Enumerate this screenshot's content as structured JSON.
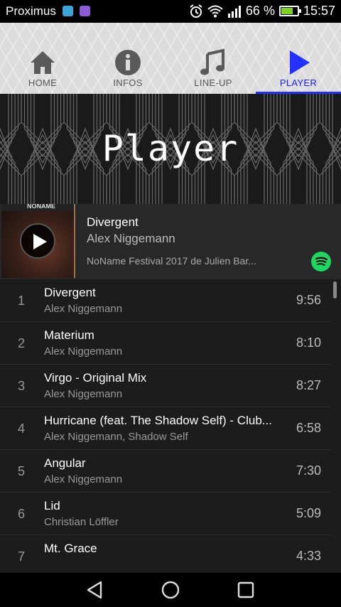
{
  "status_bar": {
    "carrier": "Proximus",
    "battery_percent": "66 %",
    "battery_level": 0.66,
    "time": "15:57",
    "icons": [
      "photo-app-icon",
      "app-icon",
      "alarm-icon",
      "wifi-icon",
      "signal-icon",
      "battery-icon"
    ]
  },
  "tabs": [
    {
      "label": "HOME",
      "icon": "home-icon"
    },
    {
      "label": "INFOS",
      "icon": "info-icon"
    },
    {
      "label": "LINE-UP",
      "icon": "music-note-icon"
    },
    {
      "label": "PLAYER",
      "icon": "play-icon",
      "active": true
    }
  ],
  "header": {
    "title": "Player"
  },
  "now_playing": {
    "track": "Divergent",
    "artist": "Alex Niggemann",
    "playlist": "NoName Festival 2017 de Julien Bar...",
    "album_text": "NONAME"
  },
  "tracks": [
    {
      "num": "1",
      "title": "Divergent",
      "artist": "Alex Niggemann",
      "duration": "9:56"
    },
    {
      "num": "2",
      "title": "Materium",
      "artist": "Alex Niggemann",
      "duration": "8:10"
    },
    {
      "num": "3",
      "title": "Virgo - Original Mix",
      "artist": "Alex Niggemann",
      "duration": "8:27"
    },
    {
      "num": "4",
      "title": "Hurricane (feat. The Shadow Self) - Club...",
      "artist": "Alex Niggemann, Shadow Self",
      "duration": "6:58"
    },
    {
      "num": "5",
      "title": "Angular",
      "artist": "Alex Niggemann",
      "duration": "7:30"
    },
    {
      "num": "6",
      "title": "Lid",
      "artist": "Christian Löffler",
      "duration": "5:09"
    },
    {
      "num": "7",
      "title": "Mt. Grace",
      "artist": "",
      "duration": "4:33"
    }
  ],
  "colors": {
    "accent": "#2430ff",
    "spotify": "#1ed760",
    "list_background": "#1c1c1c"
  }
}
